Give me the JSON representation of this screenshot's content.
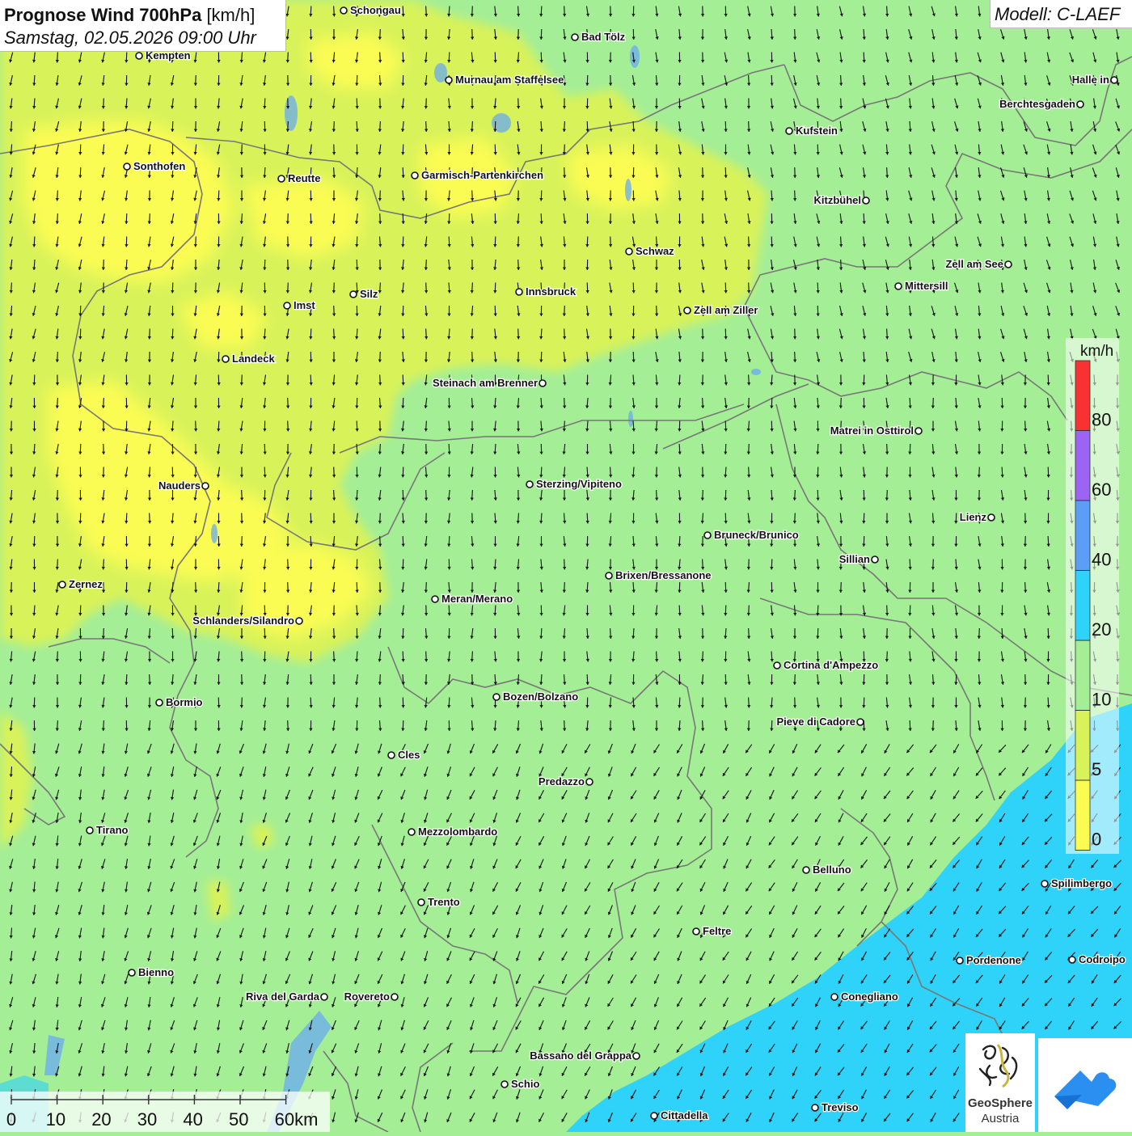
{
  "header": {
    "title_bold": "Prognose Wind 700hPa",
    "title_unit": "[km/h]",
    "datetime": "Samstag, 02.05.2026 09:00 Uhr"
  },
  "model": {
    "label": "Modell: C-LAEF"
  },
  "legend": {
    "unit": "km/h",
    "classes": [
      {
        "label": "0",
        "color": "#fbfc52"
      },
      {
        "label": "5",
        "color": "#d8f25a"
      },
      {
        "label": "10",
        "color": "#a4ee96"
      },
      {
        "label": "20",
        "color": "#2fd2f8"
      },
      {
        "label": "40",
        "color": "#5c9df7"
      },
      {
        "label": "60",
        "color": "#9c64f2"
      },
      {
        "label": "80",
        "color": "#f83232"
      }
    ]
  },
  "scale_bar": {
    "ticks": [
      "0",
      "10",
      "20",
      "30",
      "40",
      "50",
      "60km"
    ]
  },
  "cities": [
    {
      "name": "Schongau",
      "label_side": "right"
    },
    {
      "name": "Bad Tölz",
      "label_side": "right"
    },
    {
      "name": "Kempten",
      "label_side": "right"
    },
    {
      "name": "Murnau am Staffelsee",
      "label_side": "right"
    },
    {
      "name": "Halle in",
      "label_side": "left"
    },
    {
      "name": "Berchtesgaden",
      "label_side": "left"
    },
    {
      "name": "Kufstein",
      "label_side": "right"
    },
    {
      "name": "Sonthofen",
      "label_side": "right"
    },
    {
      "name": "Reutte",
      "label_side": "right"
    },
    {
      "name": "Garmisch-Partenkirchen",
      "label_side": "right"
    },
    {
      "name": "Kitzbühel",
      "label_side": "left"
    },
    {
      "name": "Schwaz",
      "label_side": "right"
    },
    {
      "name": "Zell am See",
      "label_side": "left"
    },
    {
      "name": "Mittersill",
      "label_side": "right"
    },
    {
      "name": "Innsbruck",
      "label_side": "right"
    },
    {
      "name": "Silz",
      "label_side": "right"
    },
    {
      "name": "Imst",
      "label_side": "right"
    },
    {
      "name": "Zell am Ziller",
      "label_side": "right"
    },
    {
      "name": "Landeck",
      "label_side": "right"
    },
    {
      "name": "Steinach am Brenner",
      "label_side": "left"
    },
    {
      "name": "Matrei in Osttirol",
      "label_side": "left"
    },
    {
      "name": "Nauders",
      "label_side": "left"
    },
    {
      "name": "Sterzing/Vipiteno",
      "label_side": "right"
    },
    {
      "name": "Lienz",
      "label_side": "left"
    },
    {
      "name": "Bruneck/Brunico",
      "label_side": "right"
    },
    {
      "name": "Sillian",
      "label_side": "left"
    },
    {
      "name": "Brixen/Bressanone",
      "label_side": "right"
    },
    {
      "name": "Zernez",
      "label_side": "right"
    },
    {
      "name": "Meran/Merano",
      "label_side": "right"
    },
    {
      "name": "Schlanders/Silandro",
      "label_side": "left"
    },
    {
      "name": "Cortina d'Ampezzo",
      "label_side": "right"
    },
    {
      "name": "Bozen/Bolzano",
      "label_side": "right"
    },
    {
      "name": "Bormio",
      "label_side": "right"
    },
    {
      "name": "Pieve di Cadore",
      "label_side": "left"
    },
    {
      "name": "Cles",
      "label_side": "right"
    },
    {
      "name": "Predazzo",
      "label_side": "left"
    },
    {
      "name": "Tirano",
      "label_side": "right"
    },
    {
      "name": "Mezzolombardo",
      "label_side": "right"
    },
    {
      "name": "Belluno",
      "label_side": "right"
    },
    {
      "name": "Spilimbergo",
      "label_side": "right"
    },
    {
      "name": "Trento",
      "label_side": "right"
    },
    {
      "name": "Feltre",
      "label_side": "right"
    },
    {
      "name": "Pordenone",
      "label_side": "right"
    },
    {
      "name": "Codroipo",
      "label_side": "right"
    },
    {
      "name": "Bienno",
      "label_side": "right"
    },
    {
      "name": "Riva del Garda",
      "label_side": "left"
    },
    {
      "name": "Rovereto",
      "label_side": "left"
    },
    {
      "name": "Conegliano",
      "label_side": "right"
    },
    {
      "name": "Bassano del Grappa",
      "label_side": "left"
    },
    {
      "name": "Schio",
      "label_side": "right"
    },
    {
      "name": "Treviso",
      "label_side": "right"
    },
    {
      "name": "Cittadella",
      "label_side": "right"
    }
  ],
  "logos": {
    "geosphere_line1": "GeoSphere",
    "geosphere_line2": "Austria"
  }
}
